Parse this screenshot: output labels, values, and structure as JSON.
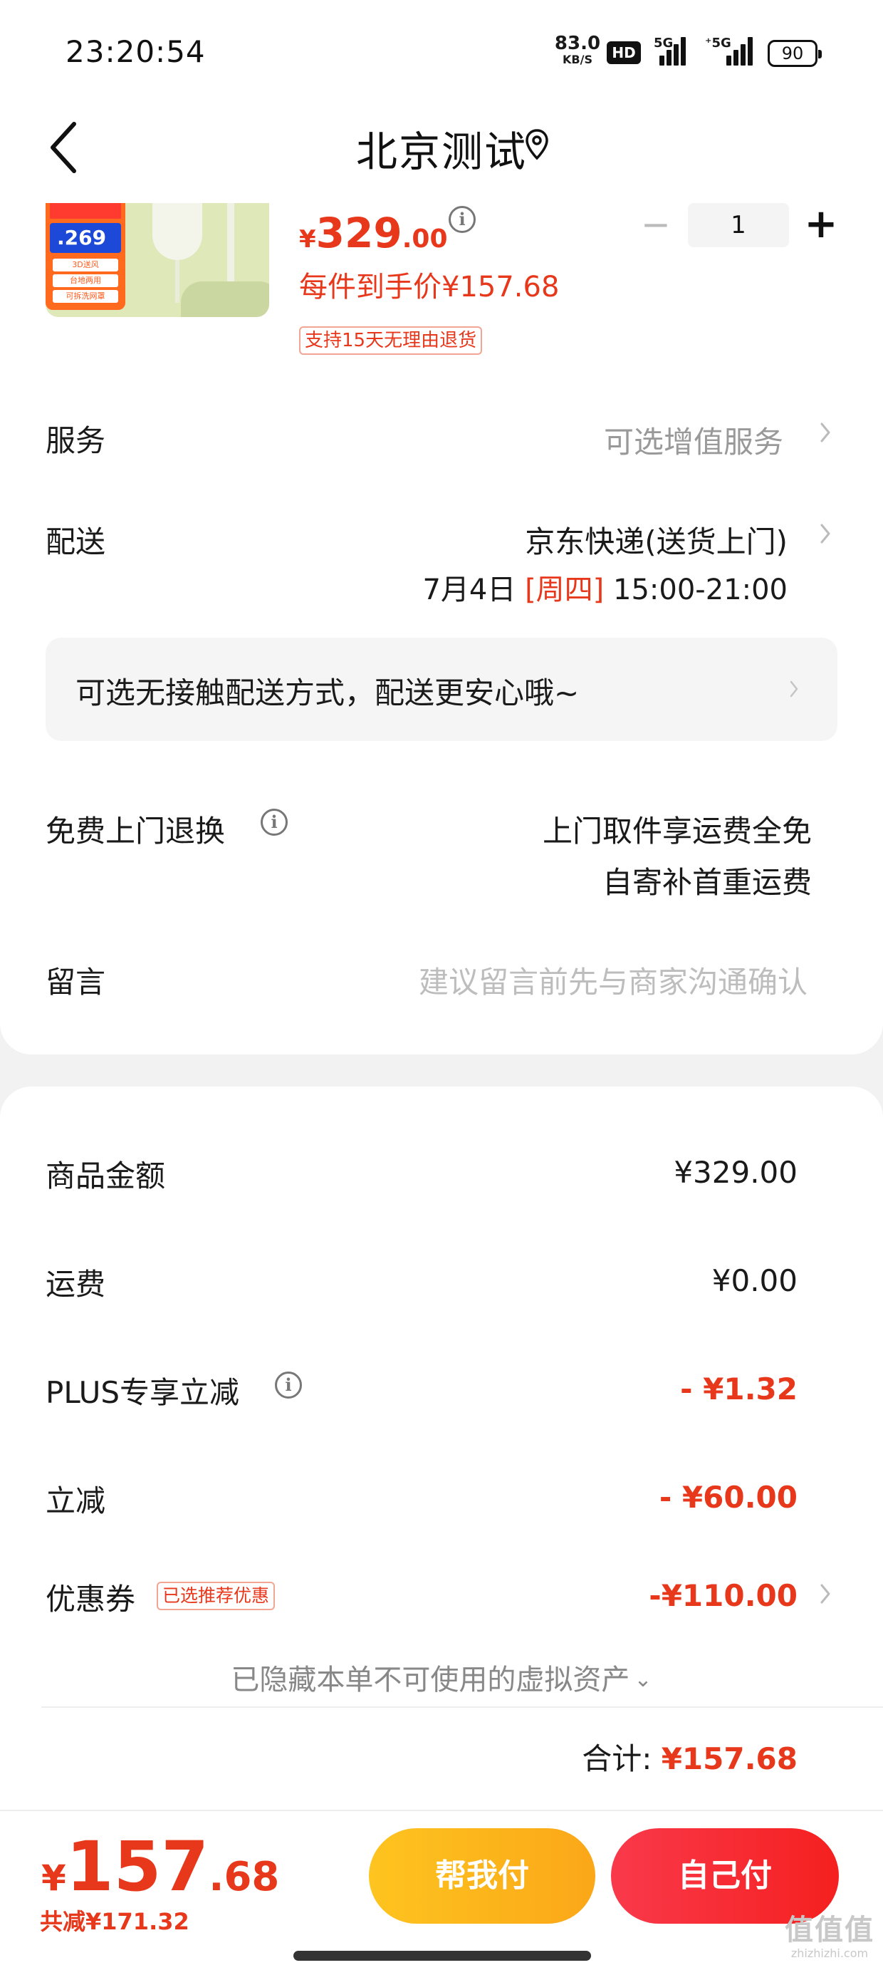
{
  "status_bar": {
    "time": "23:20:54",
    "net_speed_value": "83.0",
    "net_speed_unit": "KB/S",
    "hd_label": "HD",
    "signal1_label": "5G",
    "signal2_label": "⁺5G",
    "battery": "90"
  },
  "nav": {
    "back_icon": "chevron-left-icon",
    "title": "北京测试",
    "location_icon": "location-pin-icon"
  },
  "product": {
    "image_promo_price": ".269",
    "image_tags": [
      "3D送风",
      "台地两用",
      "可拆洗网罩"
    ],
    "price_currency": "¥",
    "price_int": "329",
    "price_dec": ".00",
    "unit_price": "每件到手价¥157.68",
    "return_tag": "支持15天无理由退货",
    "quantity": "1",
    "minus": "−",
    "plus": "+"
  },
  "rows": {
    "service_label": "服务",
    "service_value": "可选增值服务",
    "delivery_label": "配送",
    "delivery_value": "京东快递(送货上门)",
    "delivery_date": "7月4日",
    "delivery_weekday": "[周四]",
    "delivery_time": "15:00-21:00",
    "contactless": "可选无接触配送方式，配送更安心哦~",
    "return_label": "免费上门退换",
    "return_line1": "上门取件享运费全免",
    "return_line2": "自寄补首重运费",
    "message_label": "留言",
    "message_placeholder": "建议留言前先与商家沟通确认"
  },
  "summary": {
    "goods_label": "商品金额",
    "goods_value": "¥329.00",
    "shipping_label": "运费",
    "shipping_value": "¥0.00",
    "plus_label": "PLUS专享立减",
    "plus_value": "- ¥1.32",
    "discount_label": "立减",
    "discount_value": "- ¥60.00",
    "coupon_label": "优惠券",
    "coupon_tag": "已选推荐优惠",
    "coupon_value": "-¥110.00",
    "hidden_assets": "已隐藏本单不可使用的虚拟资产",
    "total_label": "合计:",
    "total_value": "¥157.68"
  },
  "action_bar": {
    "price_currency": "¥",
    "price_int": "157",
    "price_dec": ".68",
    "saved": "共减¥171.32",
    "help_pay": "帮我付",
    "self_pay": "自己付"
  },
  "watermark": {
    "mark": "值值值",
    "site": "zhizhizhi.com"
  },
  "colors": {
    "accent_red": "#e8381c",
    "help_button": "#fdb81b",
    "self_button": "#f72c33"
  }
}
